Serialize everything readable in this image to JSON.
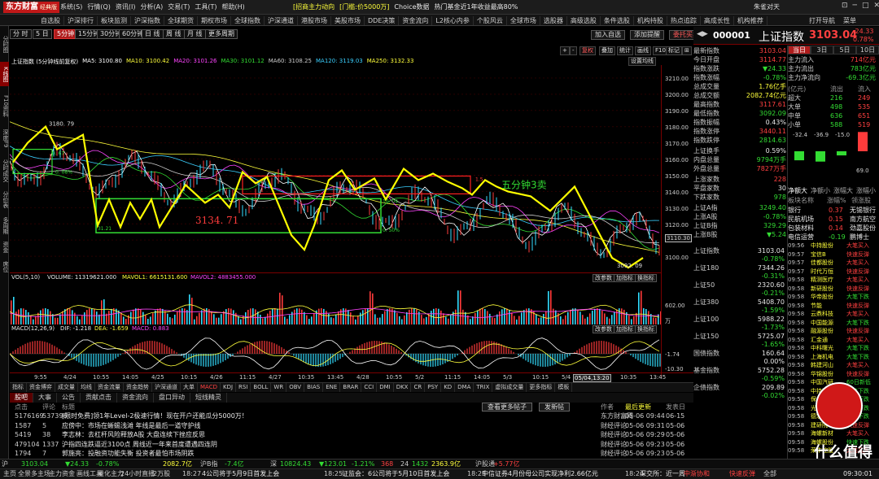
{
  "app": {
    "logo": "东方财富",
    "edition": "经典版",
    "menu": [
      "系统(S)",
      "行情(Q)",
      "资讯(I)",
      "分析(A)",
      "交易(T)",
      "工具(T)",
      "帮助(H)"
    ],
    "ticker_news": [
      "[招商主力动向",
      "[门槛:价5000万]",
      "Choice数据",
      "热门基金近1年收益最高80%"
    ],
    "user": "朱雀对天",
    "window_controls": [
      "⊡",
      "─",
      "□",
      "✕"
    ]
  },
  "navbar": {
    "items": [
      "自选股",
      "沪深排行",
      "板块监测",
      "沪深指数",
      "全球期货",
      "期权市场",
      "全球指数",
      "沪深通道",
      "港股市场",
      "美股市场",
      "DDE决策",
      "资金流向",
      "L2核心内参",
      "个股风云",
      "全球市场",
      "选股器",
      "高级选股",
      "条件选股",
      "机构持股",
      "热点追踪",
      "高成长性",
      "机构推荐"
    ],
    "right": [
      "打开导航",
      "菜单"
    ]
  },
  "left_tabs": [
    "分时图",
    "K线图",
    "F10资料",
    "深度F9",
    "分时成交",
    "分价表",
    "多周期",
    "资金",
    "席位"
  ],
  "chart_toolbar": {
    "periods": [
      "分 时",
      "5 日",
      "5分钟",
      "15分钟",
      "30分钟",
      "60分钟",
      "日 线",
      "周 线",
      "月 线",
      "更多周期"
    ],
    "selected": "5分钟",
    "actions": [
      "加入自选",
      "添加提醒",
      "委托买卖"
    ],
    "sub": [
      "+",
      "-",
      "复权",
      "叠加",
      "统计",
      "画线",
      "F10",
      "标记",
      "⊞"
    ],
    "settings": "设置均线"
  },
  "ma_line": {
    "title": "上证指数 (5分钟线前复权)",
    "items": [
      {
        "label": "MA5: 3100.80",
        "color": "#ffffff"
      },
      {
        "label": "MA10: 3100.42",
        "color": "#ffff3b"
      },
      {
        "label": "MA20: 3101.26",
        "color": "#ff44ff"
      },
      {
        "label": "MA30: 3101.12",
        "color": "#33dd33"
      },
      {
        "label": "MA60: 3108.25",
        "color": "#cccccc"
      },
      {
        "label": "MA120: 3119.03",
        "color": "#3bd0ff"
      },
      {
        "label": "MA250: 3132.33",
        "color": "#ffff3b"
      }
    ]
  },
  "chart_labels": {
    "high": "3180. 79",
    "low": "3092. 09",
    "center_price": "3134. 71",
    "sell_note": "五分钟3卖",
    "box_top_right": "1.5",
    "box_left_top": "0. 67",
    "box_left_bottom": "0. 08%",
    "box_mid_right": "10. 04",
    "box_mid_right2": "0. 50%",
    "box_mid_left": "31.21"
  },
  "y_axis": [
    "3210.00",
    "3200.00",
    "3190.00",
    "3180.00",
    "3170.00",
    "3160.00",
    "3150.00",
    "3140.00",
    "3130.00",
    "3120.00",
    "3110.30",
    "3100.00"
  ],
  "volume": {
    "header": [
      "VOL(5,10)",
      "VOLUME: 11319621.000",
      "MAVOL1: 6615131.600",
      "MAVOL2: 4883455.000"
    ],
    "pills": [
      "改参数",
      "加指标",
      "换指标"
    ],
    "ticks": [
      "602.00",
      "万"
    ]
  },
  "macd": {
    "header": [
      "MACD(12,26,9)",
      "DIF: -1.218",
      "DEA: -1.659",
      "MACD: 0.883"
    ],
    "pills": [
      "改参数",
      "加指标",
      "换指标"
    ],
    "ticks": [
      "-1.74",
      "-10.30"
    ]
  },
  "x_axis": [
    "9:55",
    "4/24",
    "10:55",
    "14:05",
    "4/25",
    "10:15",
    "4/26",
    "11:15",
    "4/27",
    "10:35",
    "13:45",
    "4/28",
    "10:55",
    "5/2",
    "11:15",
    "14:05",
    "5/3",
    "10:15",
    "5/4",
    "13:20",
    "10:35",
    "13:45"
  ],
  "x_axis_highlight": "05/04,13:20",
  "indicator_tabs": [
    "指标",
    "资金博弈",
    "成交量",
    "均线",
    "资金流量",
    "资金趋势",
    "沪深通道",
    "大单",
    "MACD",
    "KDJ",
    "RSI",
    "BOLL",
    "WR",
    "OBV",
    "BIAS",
    "ENE",
    "BRAR",
    "CCI",
    "DMI",
    "DKX",
    "CR",
    "PSY",
    "KD",
    "DMA",
    "TRIX",
    "虚拟成交量",
    "更多指标",
    "模板"
  ],
  "news": {
    "tabs": [
      "股吧",
      "大事",
      "公告",
      "贡献点击",
      "资金流向",
      "盘口异动",
      "短线精灵"
    ],
    "headers": [
      "点击",
      "评论",
      "标题",
      "作者",
      "最后更新",
      "发表日"
    ],
    "buttons": [
      "查看更多帖子",
      "发新帖"
    ],
    "rows": [
      {
        "clicks": "5176169",
        "comments": "537396",
        "title": "[限时免费]领1年Level-2极速行情！现在开户还能瓜分5000万！",
        "author": "东方财富网",
        "updated": "05-06 09:44",
        "posted": "06-15"
      },
      {
        "clicks": "1587",
        "comments": "5",
        "title": "应傍中：市场在蜥蜴浅滩 年线是最后一道守护线",
        "author": "财经评论",
        "updated": "05-06 09:31",
        "posted": "05-06"
      },
      {
        "clicks": "5419",
        "comments": "38",
        "title": "李志林：去杠杆风险释放A股 大盘连续下挫应反思",
        "author": "财经评论",
        "updated": "05-06 09:29",
        "posted": "05-06"
      },
      {
        "clicks": "479104",
        "comments": "1337",
        "title": "沪指四连跌逼近3100点 周线近一年来首度遭遇四连阴",
        "author": "财经评论",
        "updated": "05-06 09:23",
        "posted": "05-06"
      },
      {
        "clicks": "1794",
        "comments": "7",
        "title": "郭施亮：投融资功能失衡 投资者最怕市场阴跌",
        "author": "财经评论",
        "updated": "05-06 09:23",
        "posted": "05-06"
      }
    ]
  },
  "right_header": {
    "code": "000001",
    "name": "上证指数",
    "price": "3103.04",
    "change": "24.33",
    "change_pct": "0.78%"
  },
  "right_tabs": [
    "当日",
    "3日",
    "5日",
    "10日"
  ],
  "quote_stats": [
    {
      "label": "最新指数",
      "value": "3103.04",
      "color": "#ff4040"
    },
    {
      "label": "今日开盘",
      "value": "3114.77",
      "color": "#ff4040"
    },
    {
      "label": "指数涨跌",
      "value": "▼24.33",
      "color": "#33dd33"
    },
    {
      "label": "指数涨幅",
      "value": "-0.78%",
      "color": "#33dd33"
    },
    {
      "label": "总成交量",
      "value": "1.76亿手",
      "color": "#ffff3b"
    },
    {
      "label": "总成交额",
      "value": "2082.74亿元",
      "color": "#ffff3b"
    },
    {
      "label": "最高指数",
      "value": "3117.61",
      "color": "#ff4040"
    },
    {
      "label": "最低指数",
      "value": "3092.09",
      "color": "#33dd33"
    },
    {
      "label": "指数振幅",
      "value": "0.43%",
      "color": "#e8e8e8"
    },
    {
      "label": "指数涨停",
      "value": "3440.11",
      "color": "#ff4040"
    },
    {
      "label": "指数跌停",
      "value": "2814.63",
      "color": "#33dd33"
    },
    {
      "label": "上证换手",
      "value": "0.59%",
      "color": "#e8e8e8"
    },
    {
      "label": "内盘总量",
      "value": "9794万手",
      "color": "#33dd33"
    },
    {
      "label": "外盘总量",
      "value": "7827万手",
      "color": "#ff4040"
    },
    {
      "label": "上涨家数",
      "value": "228",
      "color": "#ff4040"
    },
    {
      "label": "平盘家数",
      "value": "30",
      "color": "#e8e8e8"
    },
    {
      "label": "下跌家数",
      "value": "978",
      "color": "#33dd33"
    },
    {
      "label": "上证A指",
      "value": "3249.40",
      "color": "#33dd33"
    },
    {
      "label": "上涨A股",
      "value": "-0.78%",
      "color": "#33dd33"
    },
    {
      "label": "上证B指",
      "value": "329.29",
      "color": "#33dd33"
    },
    {
      "label": "上涨B股",
      "value": "▼5.24",
      "color": "#33dd33"
    }
  ],
  "fund_flow": {
    "rows": [
      {
        "label": "主力流入",
        "value": "714亿元",
        "color": "#ff4040"
      },
      {
        "label": "主力流出",
        "value": "783亿元",
        "color": "#33dd33"
      },
      {
        "label": "主力净流向",
        "value": "-69.3亿元",
        "color": "#33dd33"
      }
    ],
    "table_head": [
      "(亿元)",
      "流出",
      "流入"
    ],
    "table": [
      {
        "label": "超大",
        "out": "216",
        "in": "249"
      },
      {
        "label": "大单",
        "out": "498",
        "in": "535"
      },
      {
        "label": "中单",
        "out": "636",
        "in": "651"
      },
      {
        "label": "小单",
        "out": "588",
        "in": "519"
      }
    ],
    "bars": [
      {
        "label": "-32.4",
        "value": -32.4
      },
      {
        "label": "-36.9",
        "value": -36.9
      },
      {
        "label": "-15.0",
        "value": -15.0
      },
      {
        "label": "69.0",
        "value": 69.0
      }
    ]
  },
  "sector_tabs": [
    "净额大",
    "净额小",
    "涨幅大",
    "涨幅小"
  ],
  "sector_head": [
    "板块名称",
    "涨幅%",
    "领涨股"
  ],
  "sectors": [
    {
      "name": "银行",
      "pct": "0.37",
      "lead": "无锡银行"
    },
    {
      "name": "民航机场",
      "pct": "0.15",
      "lead": "南方航空"
    },
    {
      "name": "包装材料",
      "pct": "0.14",
      "lead": "劲嘉股份"
    },
    {
      "name": "电信运营",
      "pct": "-0.19",
      "lead": "鹏博士"
    }
  ],
  "index_list": [
    {
      "name": "上证指数",
      "value": "3103.04",
      "pct": "-0.78%"
    },
    {
      "name": "上证180",
      "value": "7344.26",
      "pct": "-0.31%"
    },
    {
      "name": "上证50",
      "value": "2320.60",
      "pct": "-0.21%"
    },
    {
      "name": "上证380",
      "value": "5408.70",
      "pct": "-1.59%"
    },
    {
      "name": "上证100",
      "value": "5988.22",
      "pct": "-1.73%"
    },
    {
      "name": "上证150",
      "value": "5725.07",
      "pct": "-1.65%"
    },
    {
      "name": "国债指数",
      "value": "160.64",
      "pct": "0.00%"
    },
    {
      "name": "基金指数",
      "value": "5752.28",
      "pct": "-0.59%"
    },
    {
      "name": "企债指数",
      "value": "209.89",
      "pct": "-0.02%"
    }
  ],
  "flow_events": [
    {
      "time": "09:56",
      "stock": "中持股份",
      "event": "大笔买入",
      "color": "#ff4040"
    },
    {
      "time": "09:57",
      "stock": "宝信B",
      "event": "快速反弹",
      "color": "#ff4040"
    },
    {
      "time": "09:57",
      "stock": "佳都股份",
      "event": "大笔买入",
      "color": "#ff4040"
    },
    {
      "time": "09:57",
      "stock": "时代万恒",
      "event": "快速反弹",
      "color": "#ff4040"
    },
    {
      "time": "09:58",
      "stock": "精测医疗",
      "event": "大笔买入",
      "color": "#ff4040"
    },
    {
      "time": "09:58",
      "stock": "新研股份",
      "event": "快速反弹",
      "color": "#ff4040"
    },
    {
      "time": "09:58",
      "stock": "华帝股份",
      "event": "大笔下跌",
      "color": "#33dd33"
    },
    {
      "time": "09:58",
      "stock": "节能",
      "event": "快速反弹",
      "color": "#ff4040"
    },
    {
      "time": "09:58",
      "stock": "云鼎科技",
      "event": "大笔买入",
      "color": "#ff4040"
    },
    {
      "time": "09:58",
      "stock": "中国能源",
      "event": "大笔下跌",
      "color": "#33dd33"
    },
    {
      "time": "09:58",
      "stock": "融源股份",
      "event": "快速反弹",
      "color": "#ff4040"
    },
    {
      "time": "09:58",
      "stock": "汇金通",
      "event": "大笔买入",
      "color": "#ff4040"
    },
    {
      "time": "09:58",
      "stock": "中科曙光",
      "event": "大笔下跌",
      "color": "#33dd33"
    },
    {
      "time": "09:58",
      "stock": "上海机电",
      "event": "大笔下跌",
      "color": "#33dd33"
    },
    {
      "time": "09:58",
      "stock": "韩建河山",
      "event": "大笔买入",
      "color": "#ff4040"
    },
    {
      "time": "09:58",
      "stock": "华锦股份",
      "event": "快速反弹",
      "color": "#ff4040"
    },
    {
      "time": "09:58",
      "stock": "中国汽研",
      "event": "60日新低",
      "color": "#33dd33"
    },
    {
      "time": "09:58",
      "stock": "中持股份",
      "event": "大笔下跌",
      "color": "#33dd33"
    },
    {
      "time": "09:58",
      "stock": "保千里",
      "event": "大笔下跌",
      "color": "#33dd33"
    },
    {
      "time": "09:58",
      "stock": "光明地产",
      "event": "大笔下跌",
      "color": "#33dd33"
    },
    {
      "time": "09:58",
      "stock": "德宏股份",
      "event": "大笔下跌",
      "color": "#33dd33"
    },
    {
      "time": "09:58",
      "stock": "建研院",
      "event": "快速反弹",
      "color": "#ff4040"
    },
    {
      "time": "09:58",
      "stock": "海螺新材",
      "event": "大笔买入",
      "color": "#ff4040"
    },
    {
      "time": "09:58",
      "stock": "海螺股份",
      "event": "快速下跌",
      "color": "#33dd33"
    },
    {
      "time": "09:58",
      "stock": "荣丰控股",
      "event": "大笔买入",
      "color": "#ff4040"
    }
  ],
  "status_bar": {
    "items": [
      "沪",
      "3103.04",
      "▼24.33",
      "-0.78%",
      "2082.7亿",
      "沪B指",
      "-7.4亿",
      "深",
      "10824.43",
      "▼123.01",
      "-1.21%",
      "368",
      "24",
      "1432",
      "2363.9亿",
      "沪股通",
      "+5.77亿"
    ],
    "line2": [
      "主页",
      "全景多主场",
      "主力资金",
      "画线工具",
      "量化主力",
      "24小时直播",
      "2万股",
      "18:27",
      "4公司将于5月9日首发上会",
      "18:25",
      "证监会：6公司将于5月10日首发上会",
      "18:25",
      "中信证券4月份母公司实现净利2.66亿元",
      "18:24",
      "深交所：近一周",
      "中渐协和",
      "快速反弹",
      "全部",
      "09:30:01"
    ]
  },
  "watermark": "什么值得买"
}
